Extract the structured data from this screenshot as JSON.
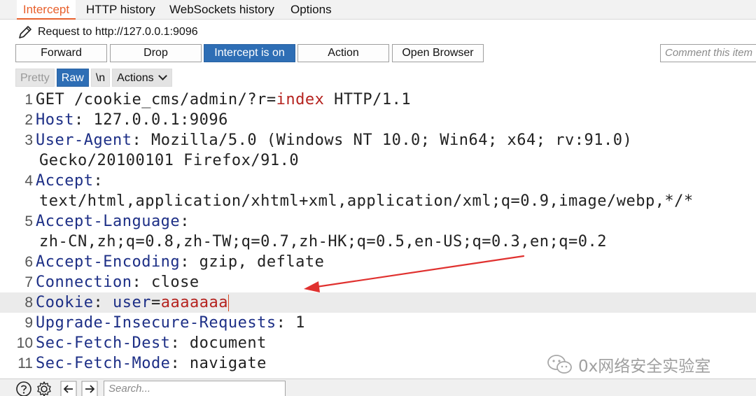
{
  "tabs": [
    {
      "label": "Intercept",
      "active": true
    },
    {
      "label": "HTTP history",
      "active": false
    },
    {
      "label": "WebSockets history",
      "active": false
    },
    {
      "label": "Options",
      "active": false
    }
  ],
  "request_target": "Request to http://127.0.0.1:9096",
  "toolbar": {
    "forward": "Forward",
    "drop": "Drop",
    "intercept": "Intercept is on",
    "action": "Action",
    "open_browser": "Open Browser",
    "comment_placeholder": "Comment this item"
  },
  "editor": {
    "pretty": "Pretty",
    "raw": "Raw",
    "newline": "\\n",
    "actions": "Actions"
  },
  "lines": {
    "l1": {
      "num": "1",
      "method": "GET /cookie_cms/admin/?",
      "pk": "r",
      "eq": "=",
      "pv": "index",
      "rest": " HTTP/1.1"
    },
    "l2": {
      "num": "2",
      "key": "Host",
      "value": ": 127.0.0.1:9096"
    },
    "l3": {
      "num": "3",
      "key": "User-Agent",
      "value": ": Mozilla/5.0 (Windows NT 10.0; Win64; x64; rv:91.0)",
      "cont": "Gecko/20100101 Firefox/91.0"
    },
    "l4": {
      "num": "4",
      "key": "Accept",
      "value": ":",
      "cont": "text/html,application/xhtml+xml,application/xml;q=0.9,image/webp,*/*"
    },
    "l5": {
      "num": "5",
      "key": "Accept-Language",
      "value": ":",
      "cont": "zh-CN,zh;q=0.8,zh-TW;q=0.7,zh-HK;q=0.5,en-US;q=0.3,en;q=0.2"
    },
    "l6": {
      "num": "6",
      "key": "Accept-Encoding",
      "value": ": gzip, deflate"
    },
    "l7": {
      "num": "7",
      "key": "Connection",
      "value": ": close"
    },
    "l8": {
      "num": "8",
      "key": "Cookie",
      "sep": ": ",
      "ck": "user",
      "eq": "=",
      "cv": "aaaaaaa"
    },
    "l9": {
      "num": "9",
      "key": "Upgrade-Insecure-Requests",
      "value": ": 1"
    },
    "l10": {
      "num": "10",
      "key": "Sec-Fetch-Dest",
      "value": ": document"
    },
    "l11": {
      "num": "11",
      "key": "Sec-Fetch-Mode",
      "value": ": navigate"
    }
  },
  "search_placeholder": "Search...",
  "watermark": "0x网络安全实验室",
  "colors": {
    "accent": "#e8602c",
    "primary_button": "#2e6eb5",
    "header_key": "#1d2f86",
    "param_value": "#b5231f",
    "annotation_arrow": "#e0312f"
  }
}
